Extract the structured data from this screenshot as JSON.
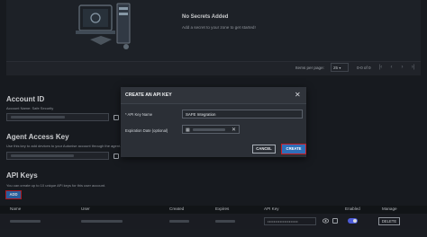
{
  "secrets": {
    "empty_title": "No Secrets Added",
    "empty_subtitle": "Add a secret to your zone to get started!",
    "items_per_page_label": "Items per page:",
    "items_per_page_value": "25",
    "range_label": "0-0 of 0"
  },
  "account_id": {
    "heading": "Account ID",
    "description": "Account Name: Safe Security"
  },
  "agent_access_key": {
    "heading": "Agent Access Key",
    "description": "Use this key to add devices to your Autonise account through the agent."
  },
  "api_keys": {
    "heading": "API Keys",
    "description": "You can create up to 10 unique API keys for this user account.",
    "add_label": "ADD",
    "columns": [
      "Name",
      "User",
      "Created",
      "Expires",
      "API Key",
      "Enabled",
      "Manage"
    ],
    "row": {
      "api_key_masked": "••••••••••••••••••••",
      "delete_label": "DELETE"
    }
  },
  "modal": {
    "title": "CREATE AN API KEY",
    "close_glyph": "✕",
    "name_label": "* API Key Name",
    "name_value": "SAFE Integration",
    "expiration_label": "Expiration Date (optional)",
    "cancel_label": "CANCEL",
    "create_label": "CREATE"
  },
  "colors": {
    "primary": "#2f6fb8",
    "highlight": "#c81d25",
    "toggle_on": "#5a6cff"
  }
}
